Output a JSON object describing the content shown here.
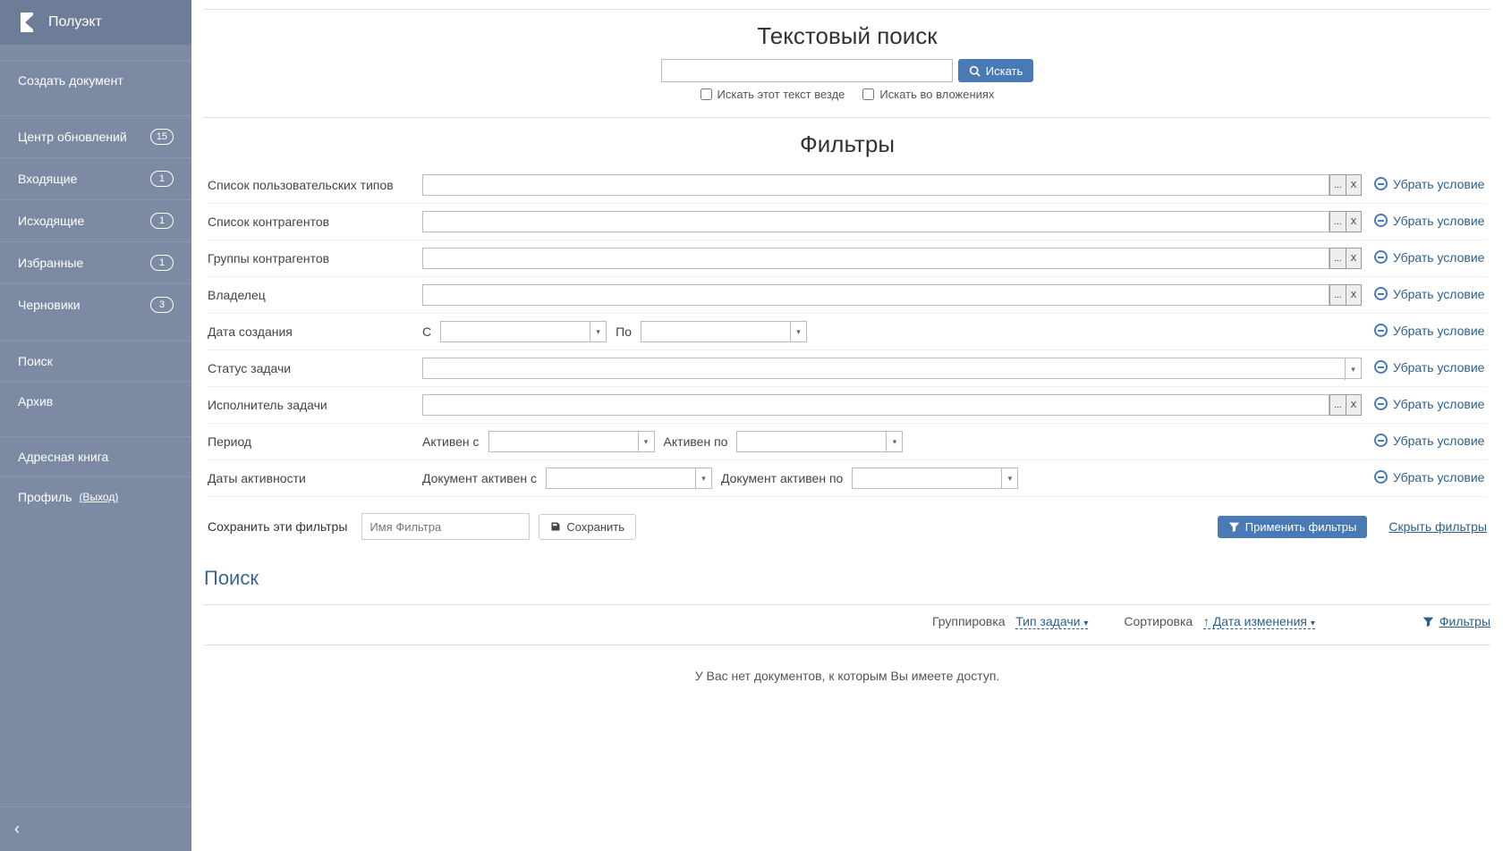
{
  "brand": {
    "title": "Полуэкт"
  },
  "sidebar": {
    "create": "Создать документ",
    "items": [
      {
        "label": "Центр обновлений",
        "badge": "15"
      },
      {
        "label": "Входящие",
        "badge": "1"
      },
      {
        "label": "Исходящие",
        "badge": "1"
      },
      {
        "label": "Избранные",
        "badge": "1"
      },
      {
        "label": "Черновики",
        "badge": "3"
      }
    ],
    "search": "Поиск",
    "archive": "Архив",
    "addressbook": "Адресная книга",
    "profile": "Профиль",
    "logout": "(Выход)"
  },
  "textsearch": {
    "title": "Текстовый поиск",
    "button": "Искать",
    "everywhere": "Искать этот текст везде",
    "attachments": "Искать во вложениях"
  },
  "filters": {
    "title": "Фильтры",
    "remove_label": "Убрать условие",
    "rows": {
      "user_types": "Список пользовательских типов",
      "contractors": "Список контрагентов",
      "contractor_groups": "Группы контрагентов",
      "owner": "Владелец",
      "created": "Дата создания",
      "status": "Статус задачи",
      "executor": "Исполнитель задачи",
      "period": "Период",
      "activity": "Даты активности"
    },
    "date_from": "С",
    "date_to": "По",
    "active_from": "Активен с",
    "active_to": "Активен по",
    "doc_active_from": "Документ активен с",
    "doc_active_to": "Документ активен по",
    "ellipsis": "...",
    "clear_x": "X"
  },
  "save_filter": {
    "label": "Сохранить эти фильтры",
    "placeholder": "Имя Фильтра",
    "save_btn": "Сохранить",
    "apply_btn": "Применить фильтры",
    "hide_link": "Скрыть фильтры"
  },
  "results": {
    "heading": "Поиск",
    "group_label": "Группировка",
    "group_value": "Тип задачи",
    "sort_label": "Сортировка",
    "sort_value": "↑ Дата изменения",
    "filters_link": "Фильтры",
    "empty": "У Вас нет документов, к которым Вы имеете доступ."
  }
}
